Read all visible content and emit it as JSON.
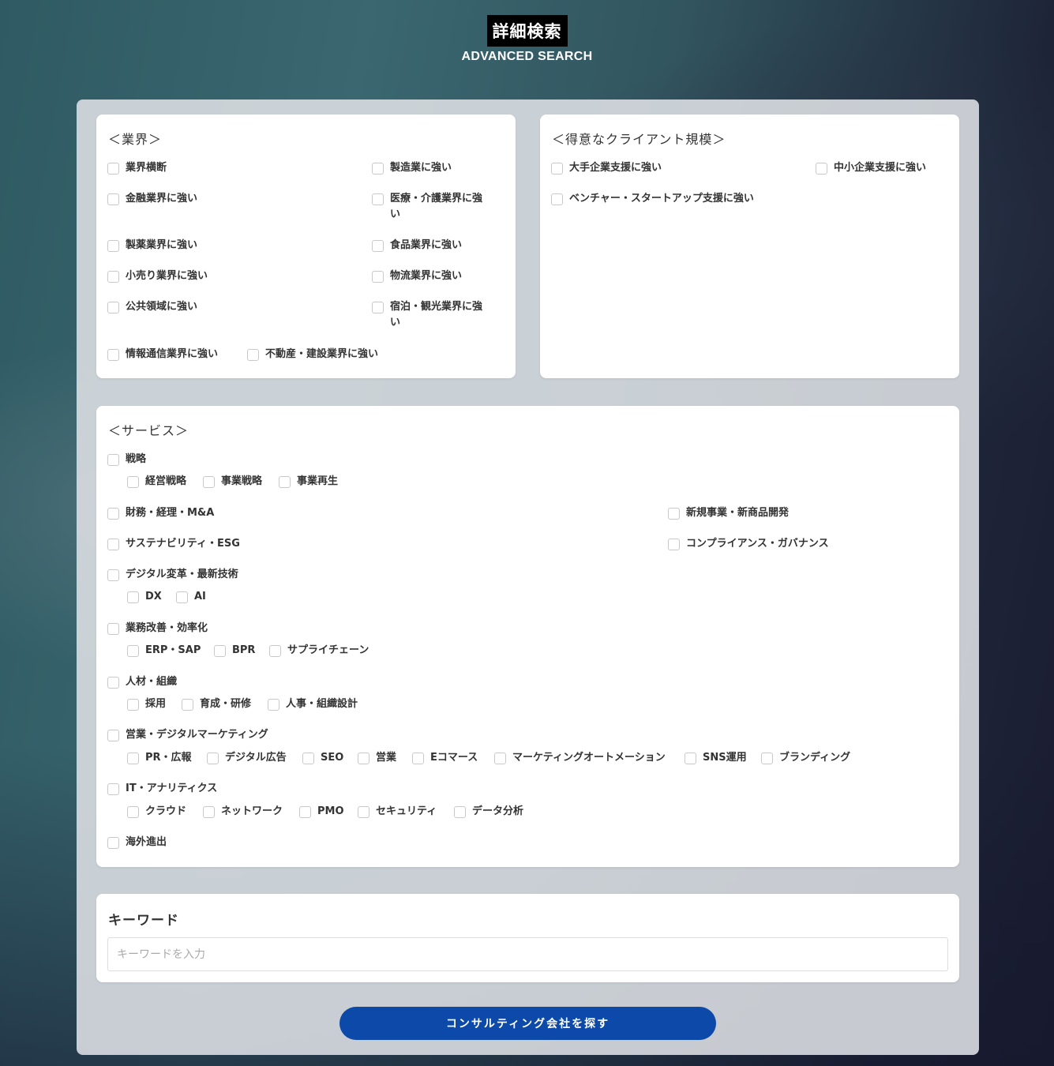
{
  "header": {
    "title": "詳細検索",
    "subtitle": "ADVANCED SEARCH"
  },
  "industry": {
    "title": "＜業界＞",
    "items": [
      "業界横断",
      "製造業に強い",
      "金融業界に強い",
      "医療・介護業界に強",
      "い",
      "製薬業界に強い",
      "食品業界に強い",
      "小売り業界に強い",
      "物流業界に強い",
      "公共領域に強い",
      "宿泊・観光業界に強",
      "い",
      "情報通信業界に強い",
      "不動産・建設業界に強い"
    ]
  },
  "client_size": {
    "title": "＜得意なクライアント規模＞",
    "items": [
      "大手企業支援に強い",
      "中小企業支援に強い",
      "ベンチャー・スタートアップ支援に強い"
    ]
  },
  "services": {
    "title": "＜サービス＞",
    "strategy": "戦略",
    "strategy_sub": [
      "経営戦略",
      "事業戦略",
      "事業再生"
    ],
    "finance": "財務・経理・M&A",
    "new_business": "新規事業・新商品開発",
    "sustainability": "サステナビリティ・ESG",
    "compliance": "コンプライアンス・ガバナンス",
    "digital": "デジタル変革・最新技術",
    "digital_sub": [
      "DX",
      "AI"
    ],
    "efficiency": "業務改善・効率化",
    "efficiency_sub": [
      "ERP・SAP",
      "BPR",
      "サプライチェーン"
    ],
    "hr": "人材・組織",
    "hr_sub": [
      "採用",
      "育成・研修",
      "人事・組織設計"
    ],
    "marketing": "営業・デジタルマーケティング",
    "marketing_sub": [
      "PR・広報",
      "デジタル広告",
      "SEO",
      "営業",
      "Eコマース",
      "マーケティングオートメーション",
      "SNS運用",
      "ブランディング"
    ],
    "it": "IT・アナリティクス",
    "it_sub": [
      "クラウド",
      "ネットワーク",
      "PMO",
      "セキュリティ",
      "データ分析"
    ],
    "overseas": "海外進出"
  },
  "keyword": {
    "title": "キーワード",
    "placeholder": "キーワードを入力"
  },
  "submit_label": "コンサルティング会社を探す"
}
